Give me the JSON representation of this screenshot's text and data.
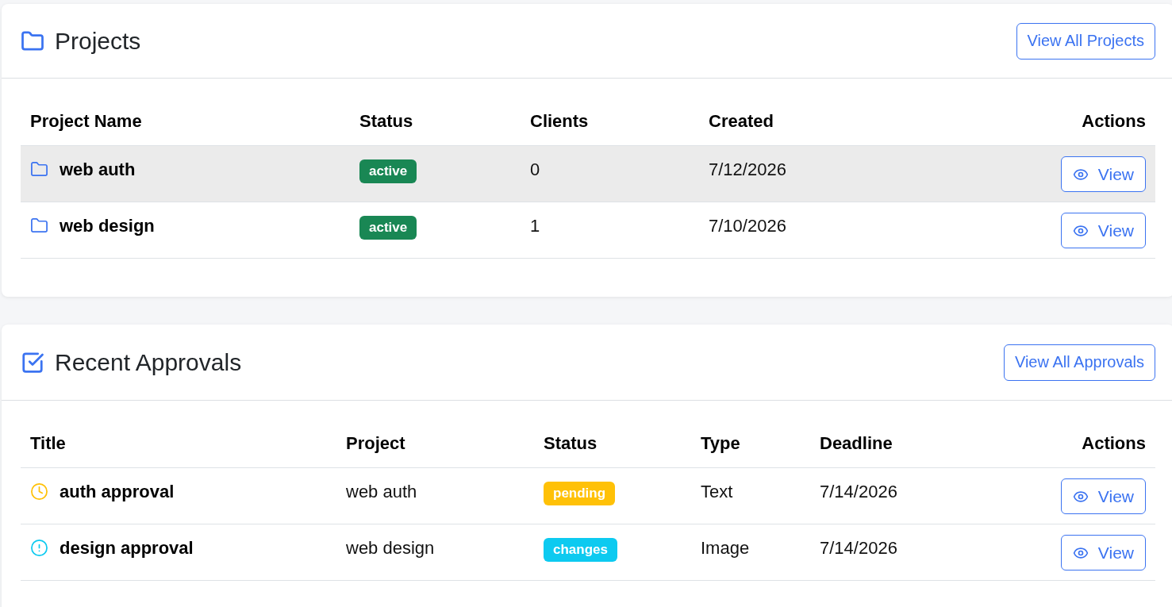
{
  "projects": {
    "title": "Projects",
    "view_all_button": "View All Projects",
    "columns": [
      "Project Name",
      "Status",
      "Clients",
      "Created",
      "Actions"
    ],
    "rows": [
      {
        "name": "web auth",
        "status": {
          "label": "active",
          "color": "#198754"
        },
        "clients": "0",
        "created": "7/12/2026",
        "action": "View",
        "highlighted": true
      },
      {
        "name": "web design",
        "status": {
          "label": "active",
          "color": "#198754"
        },
        "clients": "1",
        "created": "7/10/2026",
        "action": "View",
        "highlighted": false
      }
    ]
  },
  "approvals": {
    "title": "Recent Approvals",
    "view_all_button": "View All Approvals",
    "columns": [
      "Title",
      "Project",
      "Status",
      "Type",
      "Deadline",
      "Actions"
    ],
    "rows": [
      {
        "kind": "pending",
        "title": "auth approval",
        "project": "web auth",
        "status": {
          "label": "pending",
          "color": "#ffc107"
        },
        "type": "Text",
        "deadline": "7/14/2026",
        "action": "View"
      },
      {
        "kind": "changes",
        "title": "design approval",
        "project": "web design",
        "status": {
          "label": "changes",
          "color": "#0dcaf0"
        },
        "type": "Image",
        "deadline": "7/14/2026",
        "action": "View"
      }
    ]
  }
}
